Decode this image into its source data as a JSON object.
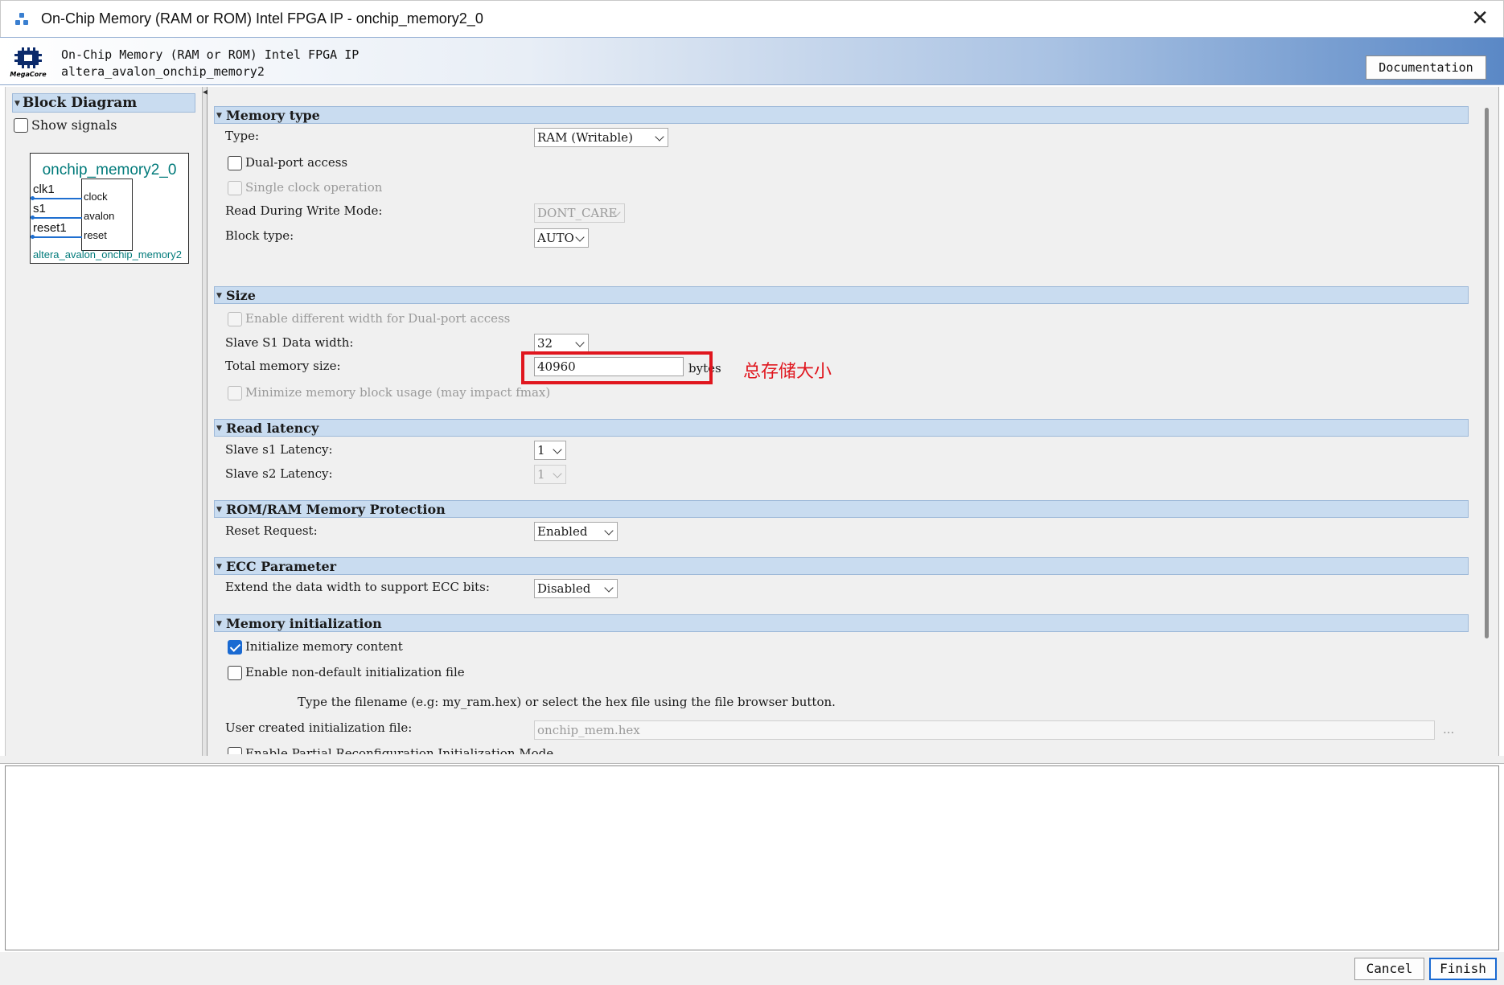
{
  "window": {
    "title": "On-Chip Memory (RAM or ROM) Intel FPGA IP - onchip_memory2_0"
  },
  "header": {
    "logo_text": "MegaCore",
    "ip_name": "On-Chip Memory (RAM or ROM) Intel FPGA IP",
    "component": "altera_avalon_onchip_memory2",
    "doc_button": "Documentation"
  },
  "left": {
    "section_title": "Block Diagram",
    "show_signals": "Show signals",
    "block": {
      "instance": "onchip_memory2_0",
      "left_ports": [
        "clk1",
        "s1",
        "reset1"
      ],
      "right_ports": [
        "clock",
        "avalon",
        "reset"
      ],
      "footer": "altera_avalon_onchip_memory2"
    }
  },
  "memory_type": {
    "title": "Memory type",
    "type_label": "Type:",
    "type_value": "RAM (Writable)",
    "dual_port": "Dual-port access",
    "single_clock": "Single clock operation",
    "rdw_label": "Read During Write Mode:",
    "rdw_value": "DONT_CARE",
    "block_type_label": "Block type:",
    "block_type_value": "AUTO"
  },
  "size": {
    "title": "Size",
    "diff_width": "Enable different width for Dual-port access",
    "s1_width_label": "Slave S1 Data width:",
    "s1_width_value": "32",
    "total_label": "Total memory size:",
    "total_value": "40960",
    "total_unit": "bytes",
    "minimize": "Minimize memory block usage (may impact fmax)"
  },
  "read_latency": {
    "title": "Read latency",
    "s1_label": "Slave s1 Latency:",
    "s1_value": "1",
    "s2_label": "Slave s2 Latency:",
    "s2_value": "1"
  },
  "protection": {
    "title": "ROM/RAM Memory Protection",
    "reset_label": "Reset Request:",
    "reset_value": "Enabled"
  },
  "ecc": {
    "title": "ECC Parameter",
    "extend_label": "Extend the data width to support ECC bits:",
    "extend_value": "Disabled"
  },
  "init": {
    "title": "Memory initialization",
    "init_content": "Initialize memory content",
    "non_default": "Enable non-default initialization file",
    "hint": "Type the filename (e.g: my_ram.hex) or select the hex file using the file browser button.",
    "file_label": "User created initialization file:",
    "file_value": "onchip_mem.hex",
    "browse": "...",
    "partial_reconfig": "Enable Partial Reconfiguration Initialization Mode"
  },
  "annotation": {
    "text": "总存储大小",
    "color": "#e0161e"
  },
  "footer": {
    "cancel": "Cancel",
    "finish": "Finish"
  },
  "colors": {
    "section_header": "#c9dcf0",
    "accent": "#1a6ad2",
    "block_text": "#007a7a"
  }
}
